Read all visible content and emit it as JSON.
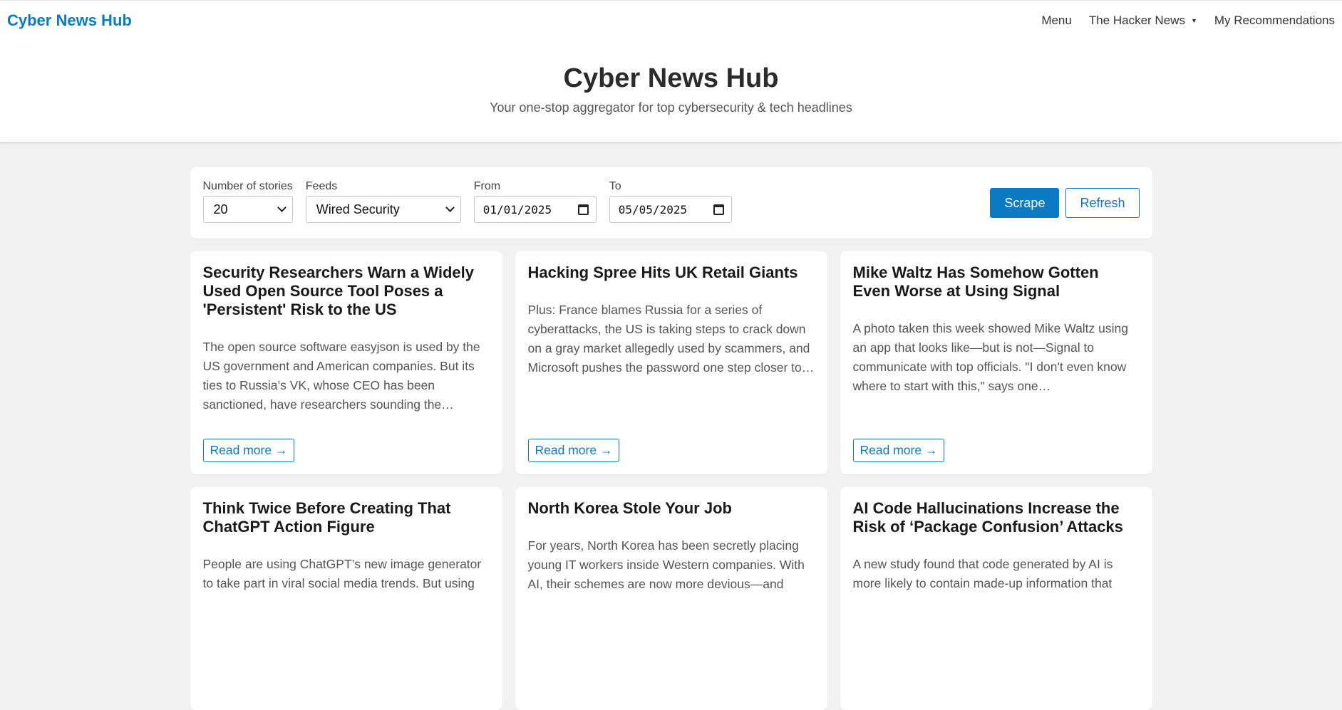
{
  "nav": {
    "brand": "Cyber News Hub",
    "links": [
      "Menu",
      "The Hacker News",
      "My Recommendations"
    ]
  },
  "hero": {
    "title": "Cyber News Hub",
    "subtitle": "Your one-stop aggregator for top cybersecurity & tech headlines"
  },
  "controls": {
    "stories_label": "Number of stories",
    "stories_value": "20",
    "feeds_label": "Feeds",
    "feeds_value": "Wired Security",
    "from_label": "From",
    "from_value": "01/01/2025",
    "to_label": "To",
    "to_value": "05/05/2025",
    "scrape_label": "Scrape",
    "refresh_label": "Refresh"
  },
  "read_more_label": "Read more →",
  "articles": [
    {
      "title": "Security Researchers Warn a Widely Used Open Source Tool Poses a 'Persistent' Risk to the US",
      "summary": "The open source software easyjson is used by the US government and American companies. But its ties to Russia’s VK, whose CEO has been sanctioned, have researchers sounding the…"
    },
    {
      "title": "Hacking Spree Hits UK Retail Giants",
      "summary": "Plus: France blames Russia for a series of cyberattacks, the US is taking steps to crack down on a gray market allegedly used by scammers, and Microsoft pushes the password one step closer to…"
    },
    {
      "title": "Mike Waltz Has Somehow Gotten Even Worse at Using Signal",
      "summary": "A photo taken this week showed Mike Waltz using an app that looks like—but is not—Signal to communicate with top officials. \"I don't even know where to start with this,\" says one…"
    },
    {
      "title": "Think Twice Before Creating That ChatGPT Action Figure",
      "summary": "People are using ChatGPT’s new image generator to take part in viral social media trends. But using"
    },
    {
      "title": "North Korea Stole Your Job",
      "summary": "For years, North Korea has been secretly placing young IT workers inside Western companies. With AI, their schemes are now more devious—and"
    },
    {
      "title": "AI Code Hallucinations Increase the Risk of ‘Package Confusion’ Attacks",
      "summary": "A new study found that code generated by AI is more likely to contain made-up information that"
    }
  ]
}
